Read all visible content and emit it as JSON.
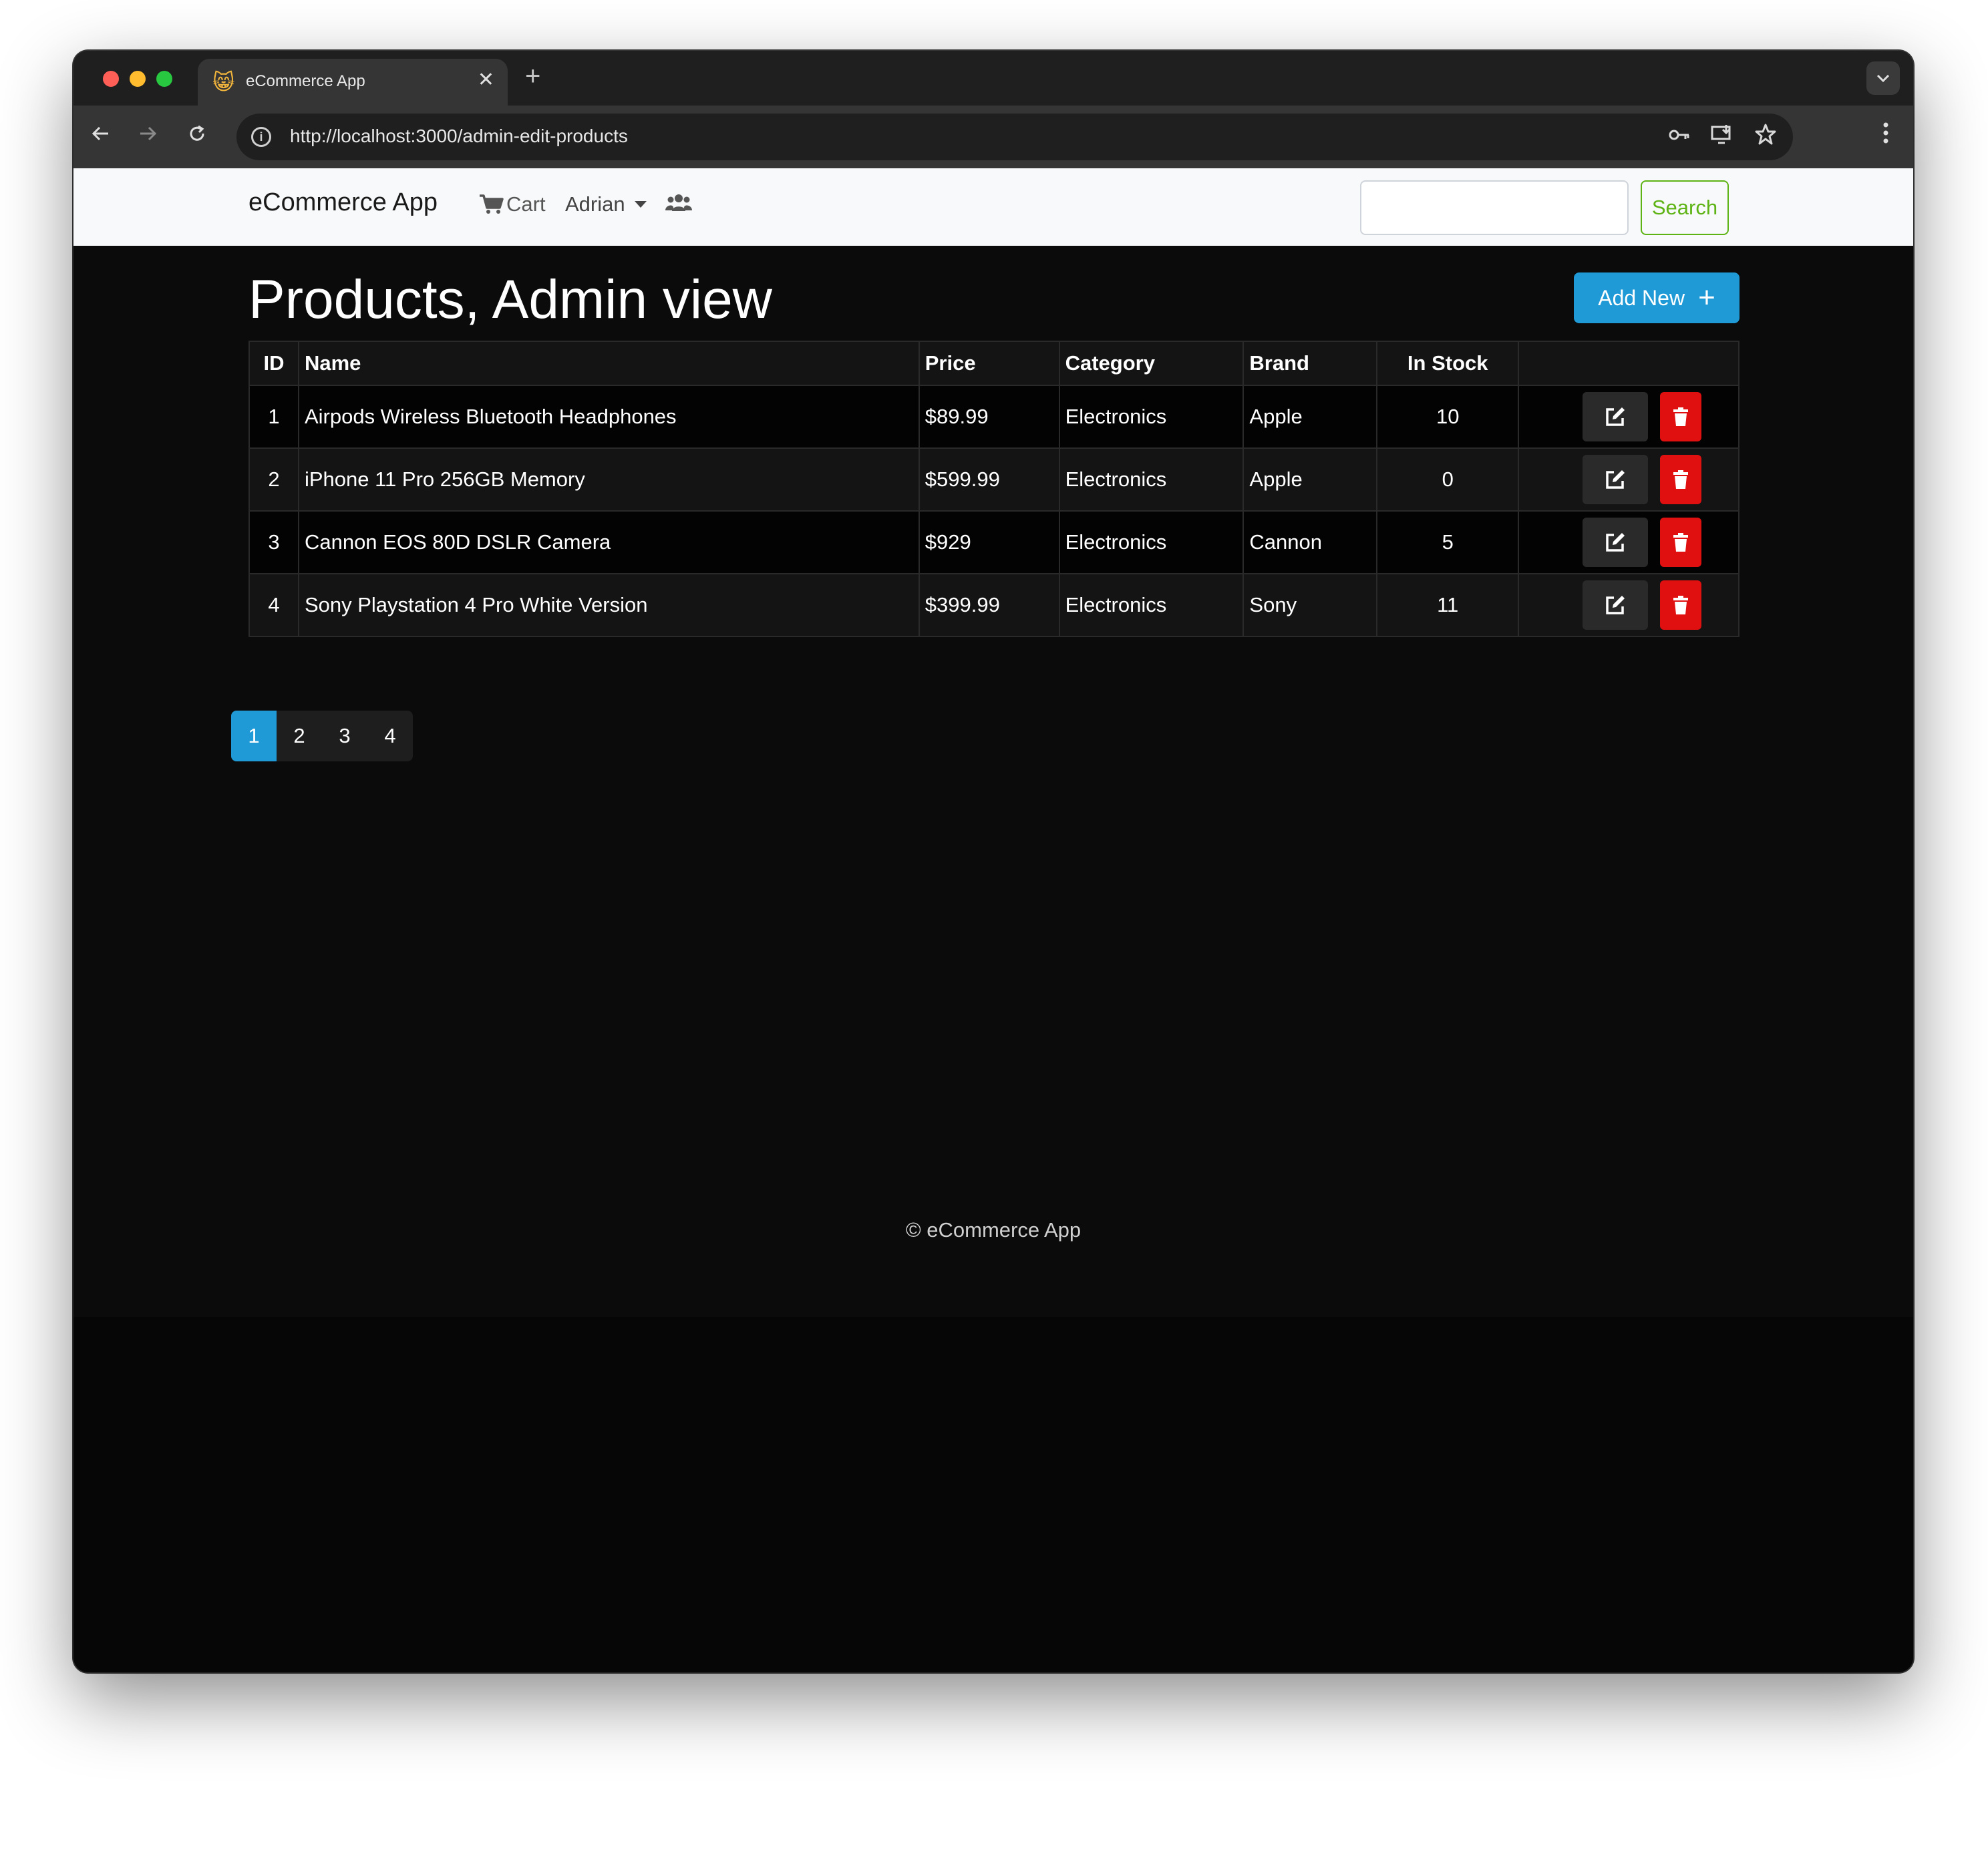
{
  "browser": {
    "tab_title": "eCommerce App",
    "tab_close": "✕",
    "new_tab": "+",
    "url": "http://localhost:3000/admin-edit-products"
  },
  "navbar": {
    "brand": "eCommerce App",
    "cart_label": "Cart",
    "user_label": "Adrian",
    "search_placeholder": "",
    "search_button": "Search"
  },
  "page": {
    "title": "Products, Admin view",
    "add_new_label": "Add New",
    "add_new_icon": "+"
  },
  "table": {
    "headers": [
      "ID",
      "Name",
      "Price",
      "Category",
      "Brand",
      "In Stock",
      ""
    ],
    "rows": [
      {
        "id": "1",
        "name": "Airpods Wireless Bluetooth Headphones",
        "price": "$89.99",
        "category": "Electronics",
        "brand": "Apple",
        "stock": "10"
      },
      {
        "id": "2",
        "name": "iPhone 11 Pro 256GB Memory",
        "price": "$599.99",
        "category": "Electronics",
        "brand": "Apple",
        "stock": "0"
      },
      {
        "id": "3",
        "name": "Cannon EOS 80D DSLR Camera",
        "price": "$929",
        "category": "Electronics",
        "brand": "Cannon",
        "stock": "5"
      },
      {
        "id": "4",
        "name": "Sony Playstation 4 Pro White Version",
        "price": "$399.99",
        "category": "Electronics",
        "brand": "Sony",
        "stock": "11"
      }
    ]
  },
  "pagination": {
    "pages": [
      "1",
      "2",
      "3",
      "4"
    ],
    "active": "1"
  },
  "footer": {
    "text": "© eCommerce App"
  },
  "colors": {
    "primary": "#1f9ad6",
    "danger": "#e01010",
    "success": "#5db314",
    "background": "#0b0b0b"
  },
  "icons": {
    "favicon": "cat-face-icon",
    "cart": "shopping-cart-icon",
    "users": "users-icon",
    "edit": "edit-icon",
    "delete": "trash-icon"
  }
}
